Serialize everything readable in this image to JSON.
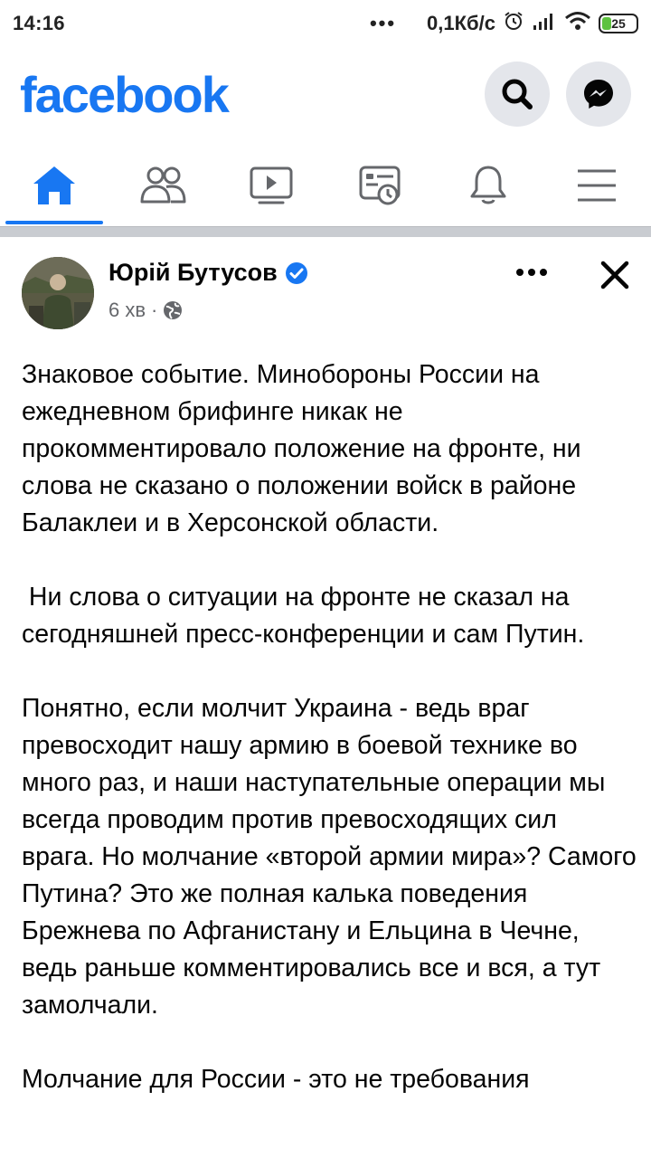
{
  "status_bar": {
    "time": "14:16",
    "dots": "•••",
    "net_speed": "0,1Кб/с",
    "battery": "25"
  },
  "header": {
    "logo": "facebook",
    "search_icon": "search-icon",
    "messenger_icon": "messenger-icon",
    "brand_color": "#1877f2"
  },
  "nav": {
    "tabs": [
      {
        "icon": "home-icon",
        "active": true
      },
      {
        "icon": "friends-icon",
        "active": false
      },
      {
        "icon": "watch-icon",
        "active": false
      },
      {
        "icon": "news-icon",
        "active": false
      },
      {
        "icon": "bell-icon",
        "active": false
      },
      {
        "icon": "menu-icon",
        "active": false
      }
    ]
  },
  "post": {
    "author": "Юрій Бутусов",
    "verified_icon": "verified-badge-icon",
    "time": "6 хв",
    "separator": "·",
    "privacy_icon": "globe-icon",
    "paragraphs": [
      "Знаковое событие. Минобороны России на ежедневном брифинге никак не прокомментировало положение на фронте, ни слова не сказано о положении войск в районе Балаклеи и в Херсонской области.",
      " Ни слова о ситуации на фронте не сказал на сегодняшней пресс-конференции и сам Путин.",
      "Понятно, если молчит Украина - ведь враг превосходит нашу армию в боевой технике во много раз, и наши наступательные операции мы всегда проводим против превосходящих сил врага. Но молчание «второй армии мира»? Самого Путина? Это же полная калька поведения Брежнева по Афганистану и Ельцина в Чечне, ведь раньше комментировались все и вся, а тут замолчали.",
      "Молчание для России - это не требования"
    ]
  }
}
